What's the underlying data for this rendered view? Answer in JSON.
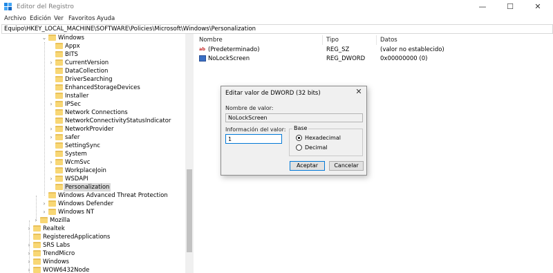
{
  "window": {
    "title": "Editor del Registro",
    "minimize": "—",
    "maximize": "☐",
    "close": "✕"
  },
  "menu": [
    "Archivo",
    "Edición",
    "Ver",
    "Favoritos",
    "Ayuda"
  ],
  "address": "Equipo\\HKEY_LOCAL_MACHINE\\SOFTWARE\\Policies\\Microsoft\\Windows\\Personalization",
  "tree": {
    "windows": "Windows",
    "children": [
      "Appx",
      "BITS",
      "CurrentVersion",
      "DataCollection",
      "DriverSearching",
      "EnhancedStorageDevices",
      "Installer",
      "IPSec",
      "Network Connections",
      "NetworkConnectivityStatusIndicator",
      "NetworkProvider",
      "safer",
      "SettingSync",
      "System",
      "WcmSvc",
      "WorkplaceJoin",
      "WSDAPI",
      "Personalization"
    ],
    "ms_siblings": [
      "Windows Advanced Threat Protection",
      "Windows Defender",
      "Windows NT"
    ],
    "top_level": [
      "Mozilla",
      "Realtek",
      "RegisteredApplications",
      "SRS Labs",
      "TrendMicro",
      "Windows",
      "WOW6432Node"
    ]
  },
  "columns": {
    "name": "Nombre",
    "type": "Tipo",
    "data": "Datos"
  },
  "values": [
    {
      "icon": "string-value-icon",
      "glyph": "ab",
      "name": "(Predeterminado)",
      "type": "REG_SZ",
      "data": "(valor no establecido)"
    },
    {
      "icon": "binary-value-icon",
      "glyph": "",
      "name": "NoLockScreen",
      "type": "REG_DWORD",
      "data": "0x00000000 (0)"
    }
  ],
  "dialog": {
    "title": "Editar valor de DWORD (32 bits)",
    "close": "✕",
    "name_label": "Nombre de valor:",
    "name_value": "NoLockScreen",
    "data_label": "Información del valor:",
    "data_value": "1",
    "base_label": "Base",
    "hex_label": "Hexadecimal",
    "dec_label": "Decimal",
    "base_selected": "Hexadecimal",
    "ok": "Aceptar",
    "cancel": "Cancelar"
  },
  "colors": {
    "folder": "#f8d775",
    "accent": "#0078d7",
    "dialog_bg": "#f0f0f0"
  }
}
